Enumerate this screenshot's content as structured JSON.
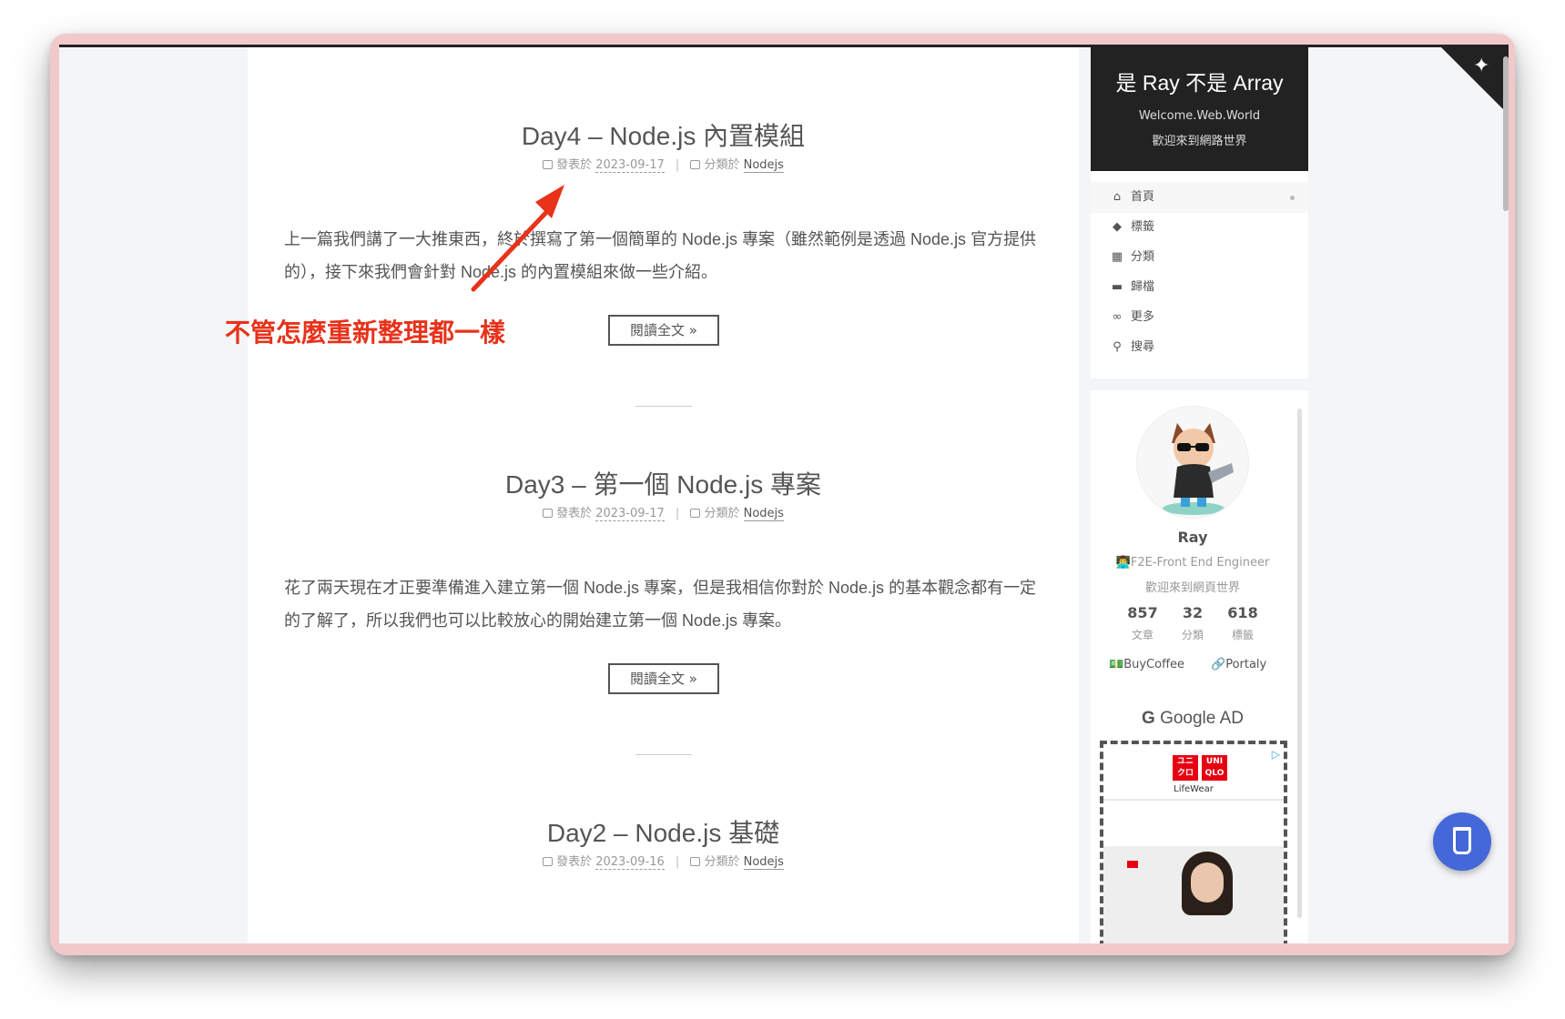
{
  "posts": [
    {
      "title": "Day4 – Node.js 內置模組",
      "meta_prefix": "發表於",
      "date": "2023-09-17",
      "cat_prefix": "分類於",
      "category": "Nodejs",
      "excerpt": "上一篇我們講了一大推東西，終於撰寫了第一個簡單的 Node.js 專案（雖然範例是透過 Node.js 官方提供的），接下來我們會針對 Node.js 的內置模組來做一些介紹。",
      "read_more": "閱讀全文 »"
    },
    {
      "title": "Day3 – 第一個 Node.js 專案",
      "meta_prefix": "發表於",
      "date": "2023-09-17",
      "cat_prefix": "分類於",
      "category": "Nodejs",
      "excerpt": "花了兩天現在才正要準備進入建立第一個 Node.js 專案，但是我相信你對於 Node.js 的基本觀念都有一定的了解了，所以我們也可以比較放心的開始建立第一個 Node.js 專案。",
      "read_more": "閱讀全文 »"
    },
    {
      "title": "Day2 – Node.js 基礎",
      "meta_prefix": "發表於",
      "date": "2023-09-16",
      "cat_prefix": "分類於",
      "category": "Nodejs"
    }
  ],
  "annotation": "不管怎麼重新整理都一樣",
  "brand": {
    "title": "是 Ray 不是 Array",
    "subtitle1": "Welcome.Web.World",
    "subtitle2": "歡迎來到網路世界"
  },
  "menu": [
    {
      "label": "首頁",
      "icon": "home-icon"
    },
    {
      "label": "標籤",
      "icon": "tags-icon"
    },
    {
      "label": "分類",
      "icon": "grid-icon"
    },
    {
      "label": "歸檔",
      "icon": "archive-icon"
    },
    {
      "label": "更多",
      "icon": "link-icon"
    },
    {
      "label": "搜尋",
      "icon": "search-icon"
    }
  ],
  "profile": {
    "name": "Ray",
    "desc": "👨‍💻F2E-Front End Engineer",
    "desc2": "歡迎來到網頁世界",
    "stats": [
      {
        "value": "857",
        "label": "文章"
      },
      {
        "value": "32",
        "label": "分類"
      },
      {
        "value": "618",
        "label": "標籤"
      }
    ],
    "links": [
      "BuyCoffee",
      "Portaly"
    ]
  },
  "ad": {
    "heading": "Google AD",
    "brand_line1": "ユニ",
    "brand_line2": "クロ",
    "brand_line3": "UNI",
    "brand_line4": "QLO",
    "sub": "LifeWear"
  },
  "colors": {
    "window_frame": "#f2c9cb",
    "accent_annotation": "#e8321a",
    "coffee_button": "#4468d9",
    "brand_bg": "#222222"
  }
}
